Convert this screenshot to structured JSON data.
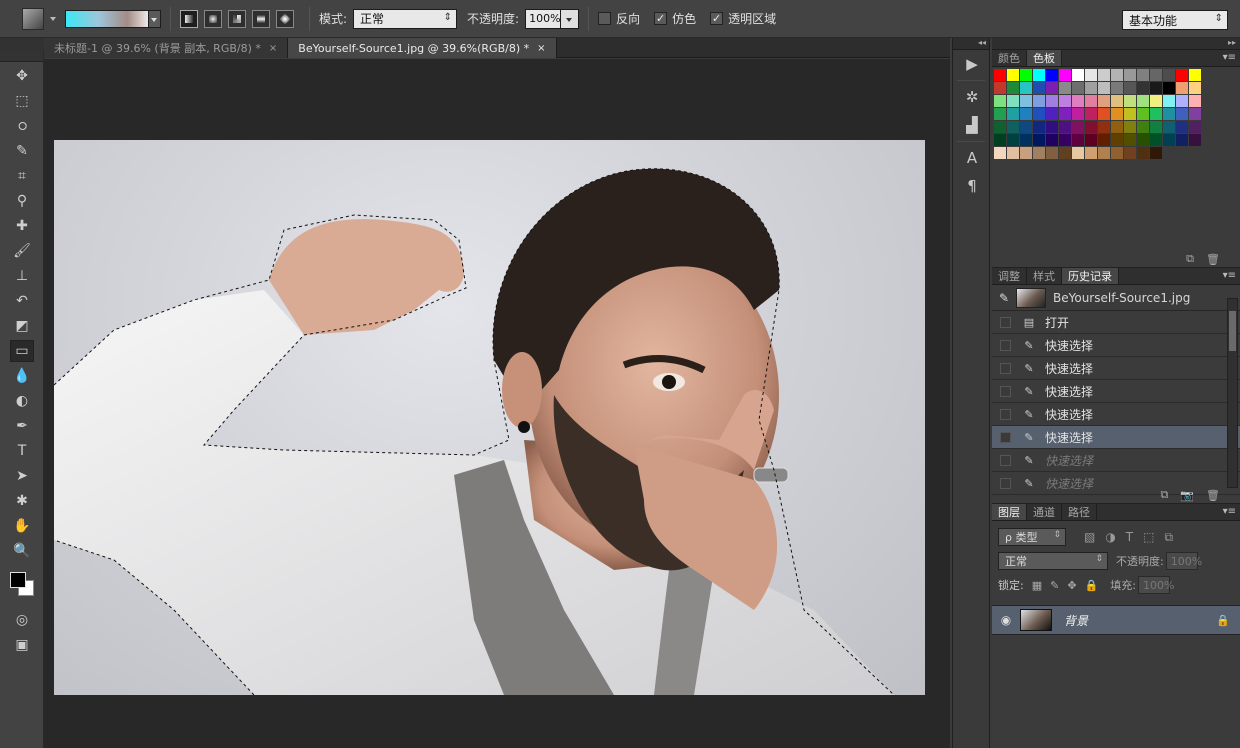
{
  "options_bar": {
    "mode_label": "模式:",
    "mode_value": "正常",
    "opacity_label": "不透明度:",
    "opacity_value": "100%",
    "reverse_label": "反向",
    "dither_label": "仿色",
    "transparency_label": "透明区域",
    "dither_checked": true,
    "transparency_checked": true,
    "workspace_value": "基本功能"
  },
  "tabs": [
    {
      "label": "未标题-1 @ 39.6% (背景 副本, RGB/8) *",
      "close": "×",
      "active": false
    },
    {
      "label": "BeYourself-Source1.jpg @ 39.6%(RGB/8) *",
      "close": "×",
      "active": true
    }
  ],
  "swatch_panel": {
    "tabs": [
      "颜色",
      "色板"
    ],
    "active_tab": "色板",
    "colors": [
      "#ff0000",
      "#ffff00",
      "#00ff00",
      "#00ffff",
      "#0000ff",
      "#ff00ff",
      "#ffffff",
      "#e6e6e6",
      "#cccccc",
      "#b3b3b3",
      "#999999",
      "#808080",
      "#666666",
      "#4d4d4d",
      "#ff0000",
      "#ffff00",
      "#c0392b",
      "#1f8a3a",
      "#27c4c4",
      "#1e4fb0",
      "#7a1fb0",
      "#8a8a8a",
      "#6e6e6e",
      "#a0a0a0",
      "#bdbdbd",
      "#7a7a7a",
      "#565656",
      "#333333",
      "#1a1a1a",
      "#000000",
      "#f0a070",
      "#ffd080",
      "#7fe07f",
      "#7fe0c0",
      "#7fc0e0",
      "#7fa0e0",
      "#a07fe0",
      "#c07fe0",
      "#e07fc0",
      "#e07fa0",
      "#e0a07f",
      "#e0c07f",
      "#c0e07f",
      "#a0e07f",
      "#f0f080",
      "#80f0f0",
      "#b0b0ff",
      "#ffb0b0",
      "#20a050",
      "#20a0a0",
      "#2080c0",
      "#2050c0",
      "#5020c0",
      "#8020c0",
      "#c020a0",
      "#c02060",
      "#e05020",
      "#e09020",
      "#c0c020",
      "#60c020",
      "#20c060",
      "#2090a0",
      "#4060c0",
      "#8040a0",
      "#106030",
      "#106060",
      "#104880",
      "#102880",
      "#301080",
      "#501080",
      "#801060",
      "#801030",
      "#903010",
      "#906010",
      "#808010",
      "#408010",
      "#108040",
      "#106070",
      "#203080",
      "#502060",
      "#004020",
      "#004040",
      "#003060",
      "#001860",
      "#200060",
      "#380060",
      "#600040",
      "#600020",
      "#602000",
      "#604000",
      "#505000",
      "#285000",
      "#005028",
      "#004050",
      "#102060",
      "#381040",
      "#f2d6c0",
      "#e0c0a0",
      "#c8a080",
      "#a08060",
      "#806040",
      "#604020",
      "#e8c8a0",
      "#d0a070",
      "#b08050",
      "#906030",
      "#704020",
      "#503010",
      "#301808",
      "",
      "",
      ""
    ],
    "footer_new": "⧉",
    "footer_delete": "🗑"
  },
  "history_panel": {
    "tabs": [
      "调整",
      "样式",
      "历史记录"
    ],
    "active_tab": "历史记录",
    "snapshot_name": "BeYourself-Source1.jpg",
    "items": [
      {
        "label": "打开",
        "state": "normal"
      },
      {
        "label": "快速选择",
        "state": "normal"
      },
      {
        "label": "快速选择",
        "state": "normal"
      },
      {
        "label": "快速选择",
        "state": "normal"
      },
      {
        "label": "快速选择",
        "state": "normal"
      },
      {
        "label": "快速选择",
        "state": "selected"
      },
      {
        "label": "快速选择",
        "state": "dimmed"
      },
      {
        "label": "快速选择",
        "state": "dimmed"
      }
    ]
  },
  "layers_panel": {
    "tabs": [
      "图层",
      "通道",
      "路径"
    ],
    "active_tab": "图层",
    "filter_label": "ρ 类型",
    "blend_mode": "正常",
    "opacity_label": "不透明度:",
    "opacity_value": "100%",
    "lock_label": "锁定:",
    "fill_label": "填充:",
    "fill_value": "100%",
    "layer_name": "背景"
  }
}
